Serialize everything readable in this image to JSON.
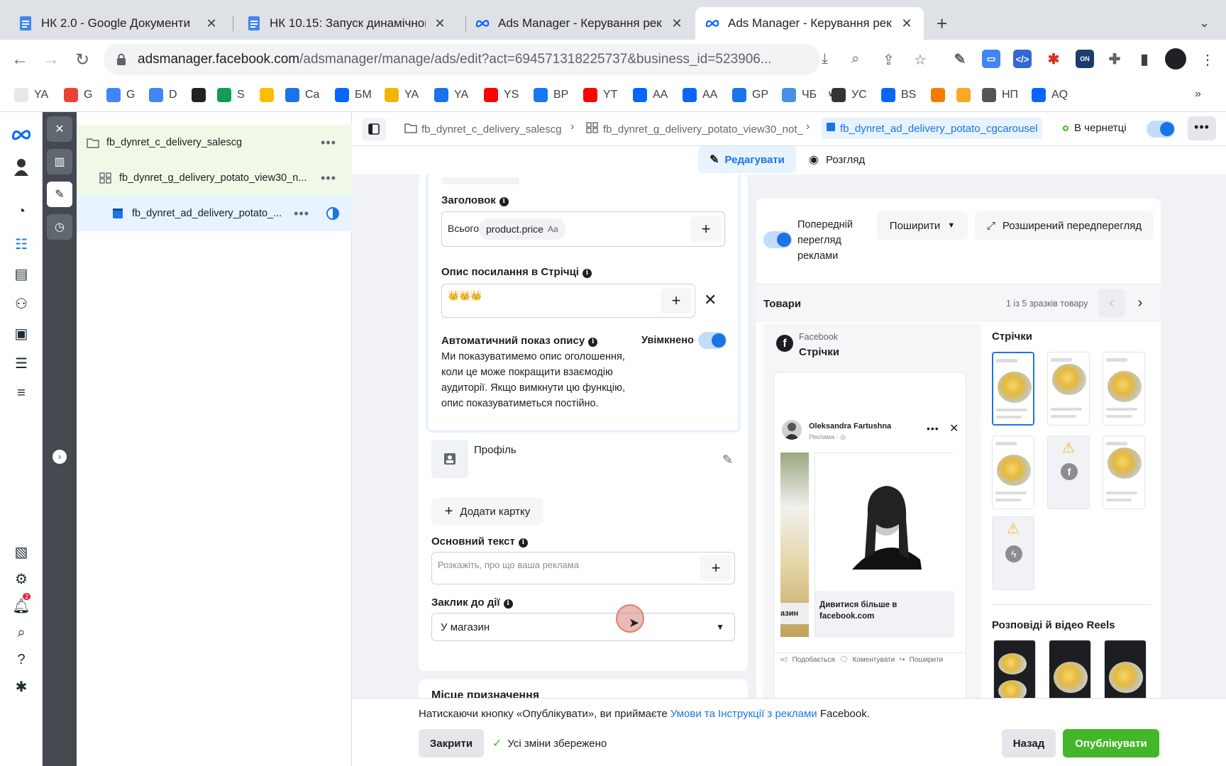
{
  "tabs": [
    {
      "title": "НК 2.0 - Google Документи",
      "icon": "docs-icon"
    },
    {
      "title": "НК 10.15: Запуск динамічного",
      "icon": "docs-icon"
    },
    {
      "title": "Ads Manager - Керування рек",
      "icon": "meta-icon"
    },
    {
      "title": "Ads Manager - Керування рек",
      "icon": "meta-icon"
    }
  ],
  "browser": {
    "url_host": "adsmanager.facebook.com",
    "url_rest": "/adsmanager/manage/ads/edit?act=694571318225737&business_id=523906..."
  },
  "bookmarks": [
    {
      "label": "YA",
      "color": "#e8e8e8"
    },
    {
      "label": "G",
      "color": "#ea4335"
    },
    {
      "label": "G",
      "color": "#4285f4"
    },
    {
      "label": "D",
      "color": "#4285f4"
    },
    {
      "label": "",
      "color": "#202124"
    },
    {
      "label": "S",
      "color": "#0f9d58"
    },
    {
      "label": "",
      "color": "#fbbc04"
    },
    {
      "label": "Ca",
      "color": "#1a73e8"
    },
    {
      "label": "БМ",
      "color": "#0866ff"
    },
    {
      "label": "YA",
      "color": "#f4b400"
    },
    {
      "label": "YA",
      "color": "#1a73e8"
    },
    {
      "label": "YS",
      "color": "#ff0000"
    },
    {
      "label": "BP",
      "color": "#1877f2"
    },
    {
      "label": "YT",
      "color": "#ff0000"
    },
    {
      "label": "AA",
      "color": "#0866ff"
    },
    {
      "label": "AA",
      "color": "#0866ff"
    },
    {
      "label": "GP",
      "color": "#1a73e8"
    },
    {
      "label": "ЧБ",
      "color": "#4a90e2"
    },
    {
      "label": "УС",
      "color": "#333333"
    },
    {
      "label": "BS",
      "color": "#0866ff"
    },
    {
      "label": "",
      "color": "#f57c00"
    },
    {
      "label": "",
      "color": "#f9a825"
    },
    {
      "label": "НП",
      "color": "#555555"
    },
    {
      "label": "AQ",
      "color": "#0866ff"
    }
  ],
  "bookmarks_wx": "wx",
  "tree": {
    "campaign": "fb_dynret_c_delivery_salescg",
    "adset": "fb_dynret_g_delivery_potato_view30_n...",
    "ad": "fb_dynret_ad_delivery_potato_..."
  },
  "breadcrumb": {
    "campaign": "fb_dynret_c_delivery_salescg",
    "adset": "fb_dynret_g_delivery_potato_view30_not_",
    "ad": "fb_dynret_ad_delivery_potato_cgcarousel",
    "status": "В чернетці"
  },
  "modes": {
    "edit": "Редагувати",
    "view": "Розгляд"
  },
  "form": {
    "headline_label": "Заголовок",
    "headline_prefix": "Всього",
    "headline_token": "product.price",
    "headline_token_suffix": "Aa",
    "link_desc_label": "Опис посилання в Стрічці",
    "link_desc_value": "👑👑👑",
    "auto_desc_label": "Автоматичний показ опису",
    "auto_desc_state": "Увімкнено",
    "auto_desc_text": "Ми показуватимемо опис оголошення, коли це може покращити взаємодію аудиторії. Якщо вимкнути цю функцію, опис показуватиметься постійно.",
    "profile_label": "Профіль",
    "add_card": "Додати картку",
    "primary_text_label": "Основний текст",
    "primary_text_placeholder": "Розкажіть, про що ваша реклама",
    "cta_label": "Заклик до дії",
    "cta_value": "У магазин",
    "next_section": "Місце призначення"
  },
  "preview": {
    "toggle_label": "Попередній перегляд реклами",
    "share": "Поширити",
    "expanded": "Розширений передперегляд",
    "products_label": "Товари",
    "products_count": "1 із 5 зразків товару",
    "platform": "Facebook",
    "placement": "Стрічки",
    "feeds_label": "Стрічки",
    "reels_label": "Розповіді й відео Reels",
    "post_author": "Oleksandra Fartushna",
    "post_sponsored": "Реклама · ◎",
    "card_cta": "Дивитися більше в facebook.com",
    "side_card_text": "азин",
    "like": "Подобається",
    "comment": "Коментувати",
    "share_action": "Поширити"
  },
  "footer": {
    "terms_prefix": "Натискаючи кнопку «Опублікувати», ви приймаєте ",
    "terms_link": "Умови та Інструкції з реклами",
    "terms_suffix": " Facebook.",
    "close": "Закрити",
    "saved": "Усі зміни збережено",
    "back": "Назад",
    "publish": "Опублікувати"
  },
  "notifications_count": "2",
  "colors": {
    "accent": "#1b74e4",
    "publish": "#42b72a",
    "tree_selected": "#e7f3ff",
    "tree_hover": "#f0f9e8"
  }
}
